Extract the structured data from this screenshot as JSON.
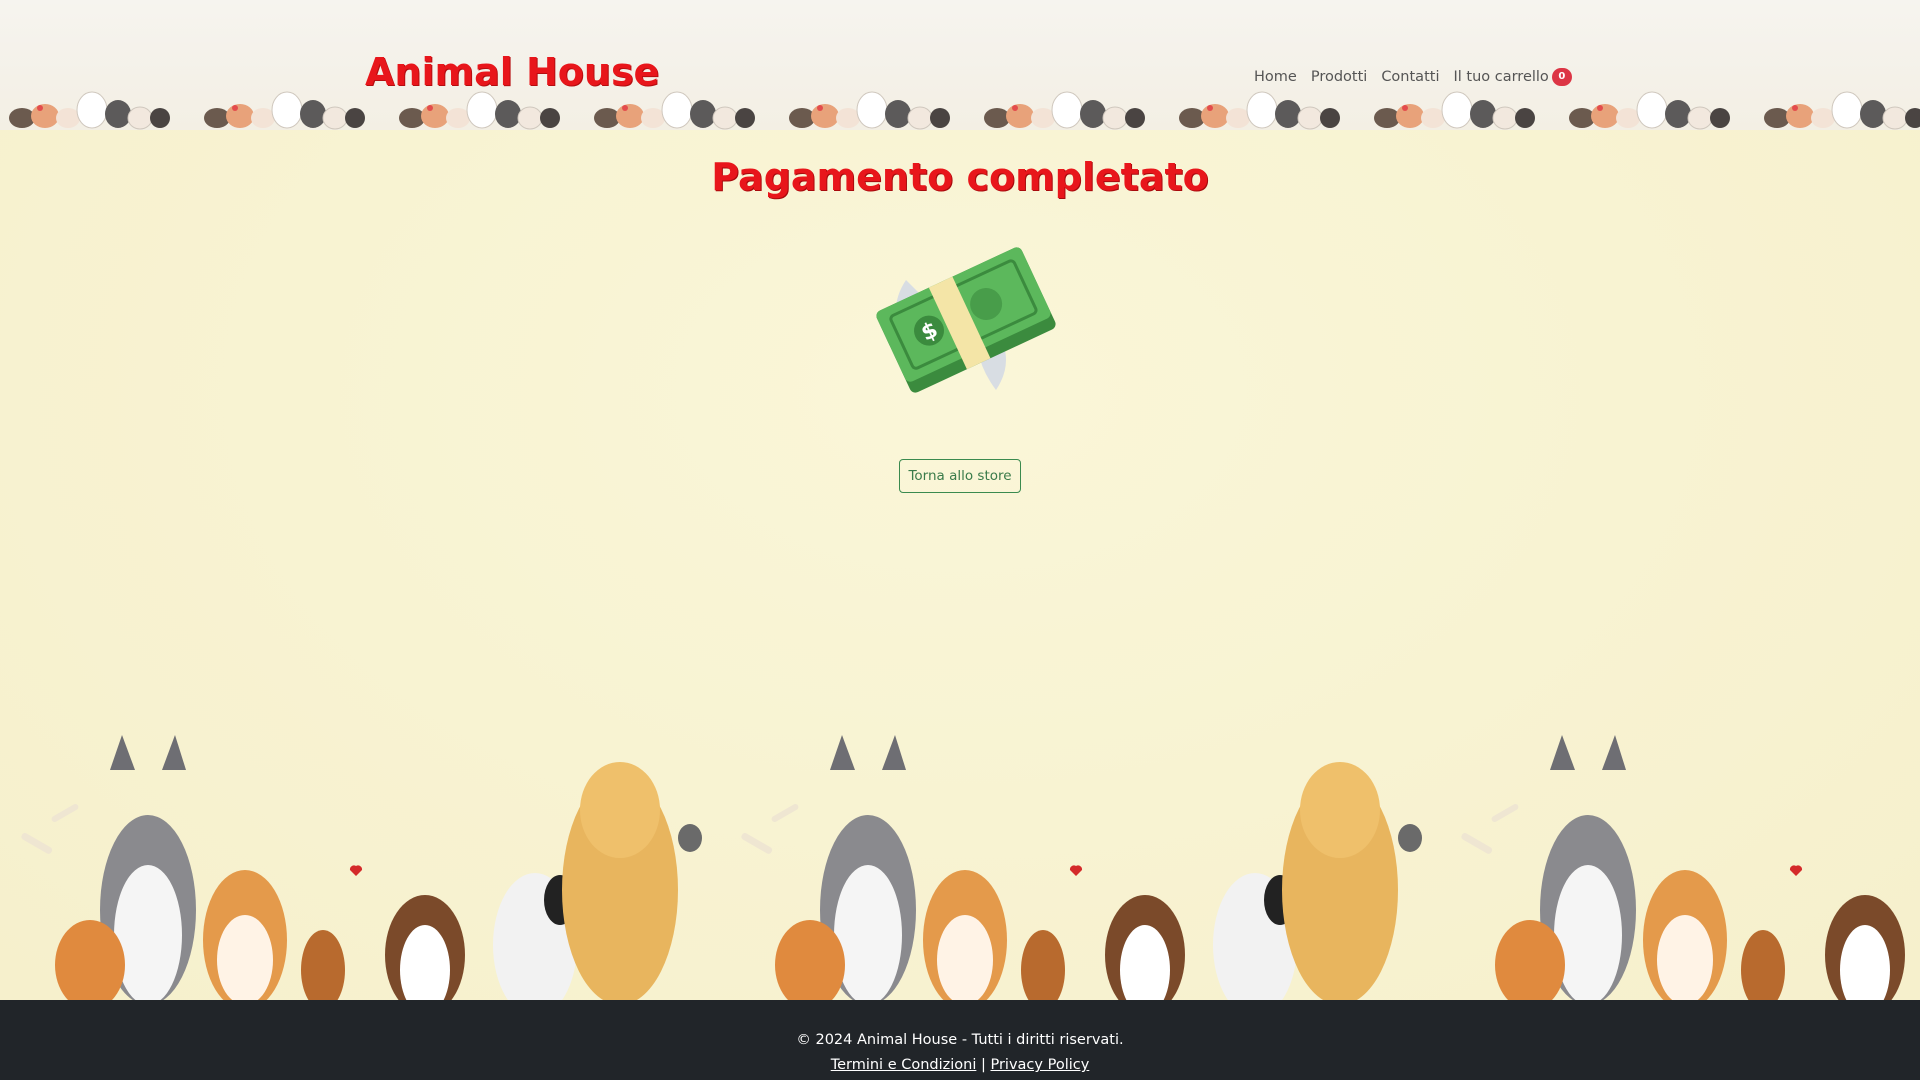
{
  "header": {
    "brand": "Animal House",
    "nav": [
      {
        "label": "Home"
      },
      {
        "label": "Prodotti"
      },
      {
        "label": "Contatti"
      }
    ],
    "cart": {
      "label": "Il tuo carrello",
      "count": "0"
    }
  },
  "main": {
    "title": "Pagamento completato",
    "illustration": "money-with-wings-icon",
    "back_button": "Torna allo store"
  },
  "footer": {
    "copyright": "© 2024 Animal House - Tutti i diritti riservati.",
    "separator": "|",
    "terms": "Termini e Condizioni",
    "privacy": "Privacy Policy"
  },
  "colors": {
    "brand_red": "#e8161b",
    "badge_red": "#dc3545",
    "button_green": "#3a8a4e",
    "footer_bg": "#212529",
    "page_bg": "#f8f3d2"
  }
}
